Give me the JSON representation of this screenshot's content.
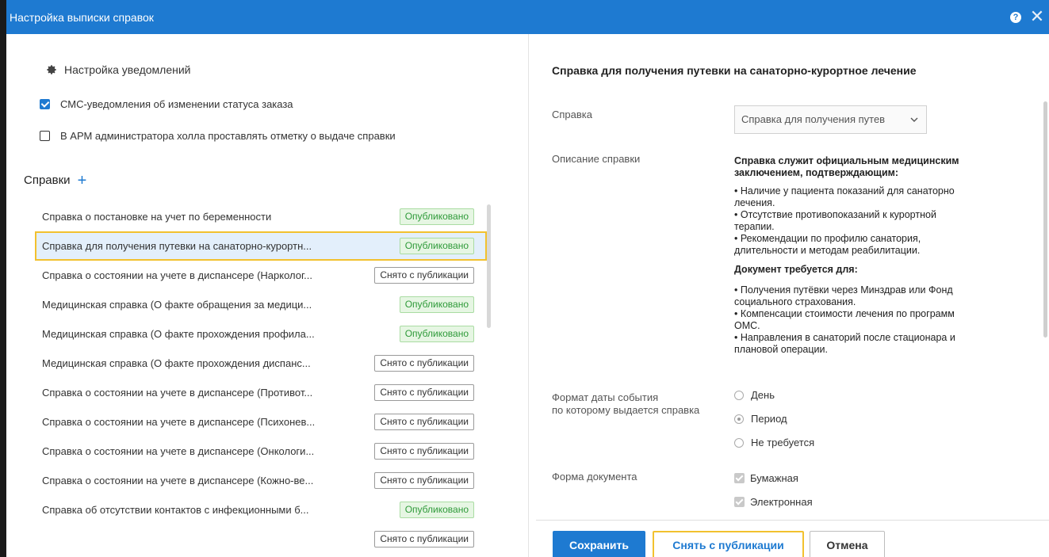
{
  "window": {
    "title": "Настройка выписки справок"
  },
  "notifications": {
    "header": "Настройка уведомлений",
    "options": [
      {
        "label": "СМС-уведомления об изменении статуса заказа",
        "checked": true
      },
      {
        "label": "В АРМ администратора холла проставлять отметку о выдаче справки",
        "checked": false
      }
    ]
  },
  "certificates": {
    "title": "Справки",
    "items": [
      {
        "name": "Справка о постановке на учет по беременности",
        "status": "Опубликовано"
      },
      {
        "name": "Справка для получения путевки на санаторно-курортн...",
        "status": "Опубликовано"
      },
      {
        "name": "Справка о состоянии на учете в диспансере (Нарколог...",
        "status": "Снято с публикации"
      },
      {
        "name": "Медицинская справка (О факте обращения за медици...",
        "status": "Опубликовано"
      },
      {
        "name": "Медицинская справка (О факте прохождения профила...",
        "status": "Опубликовано"
      },
      {
        "name": "Медицинская справка (О факте прохождения диспанс...",
        "status": "Снято с публикации"
      },
      {
        "name": "Справка о состоянии на учете в диспансере (Противот...",
        "status": "Снято с публикации"
      },
      {
        "name": "Справка о состоянии на учете в диспансере (Психонев...",
        "status": "Снято с публикации"
      },
      {
        "name": "Справка о состоянии на учете в диспансере (Онкологи...",
        "status": "Снято с публикации"
      },
      {
        "name": "Справка о состоянии на учете в диспансере (Кожно-ве...",
        "status": "Снято с публикации"
      },
      {
        "name": "Справка об отсутствии контактов с инфекционными б...",
        "status": "Опубликовано"
      },
      {
        "name": "",
        "status": "Снято с публикации"
      }
    ]
  },
  "detail": {
    "title": "Справка для получения путевки на санаторно-курортное лечение",
    "certificate_label": "Справка",
    "certificate_value": "Справка для получения путев",
    "description_label": "Описание справки",
    "description": {
      "intro": "Справка служит официальным медицинским заключением, подтверждающим:",
      "items1": [
        "•  Наличие у пациента показаний для санаторно",
        "лечения.",
        "•  Отсутствие противопоказаний к курортной",
        "терапии.",
        "•  Рекомендации по профилю санатория,",
        "длительности и методам реабилитации."
      ],
      "heading2": "Документ требуется для:",
      "items2": [
        "•  Получения путёвки через Минздрав или Фонд",
        "социального страхования.",
        "•  Компенсации стоимости лечения по программ",
        "ОМС.",
        "•  Направления в санаторий после стационара и",
        "плановой операции."
      ]
    },
    "date_format_label_1": "Формат даты события",
    "date_format_label_2": "по которому выдается справка",
    "date_format_options": [
      "День",
      "Период",
      "Не требуется"
    ],
    "date_format_selected": "Период",
    "document_form_label": "Форма документа",
    "document_form_options": [
      "Бумажная",
      "Электронная"
    ]
  },
  "buttons": {
    "save": "Сохранить",
    "unpublish": "Снять с публикации",
    "cancel": "Отмена"
  },
  "colors": {
    "accent": "#1e7ad1",
    "highlight": "#f2c12e",
    "published_text": "#2e9a39",
    "selected_row": "#e3effb"
  }
}
